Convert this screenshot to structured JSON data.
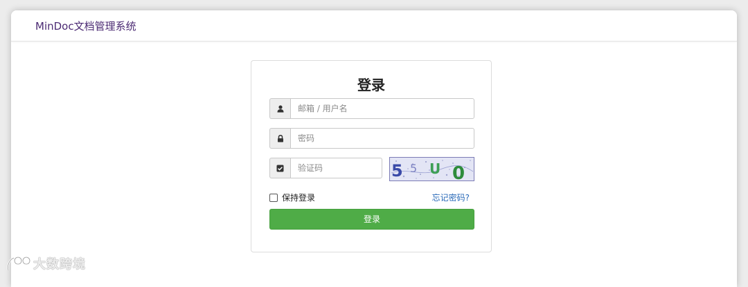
{
  "header": {
    "brand": "MinDoc文档管理系统"
  },
  "login": {
    "title": "登录",
    "account_placeholder": "邮箱 / 用户名",
    "password_placeholder": "密码",
    "captcha_placeholder": "验证码",
    "captcha_text": "5 5 U 0",
    "remember_label": "保持登录",
    "remember_checked": false,
    "forgot_label": "忘记密码?",
    "submit_label": "登录"
  },
  "icons": {
    "account": "user-icon",
    "password": "lock-icon",
    "captcha": "check-square-icon"
  },
  "colors": {
    "brand": "#4b2a73",
    "primary_button": "#4fac47",
    "link": "#2a6ab8"
  },
  "watermark": "大数跨境"
}
